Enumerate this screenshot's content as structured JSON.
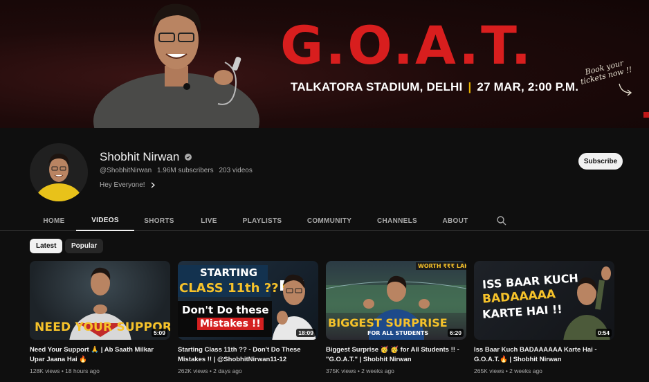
{
  "banner": {
    "headline": "G.O.A.T.",
    "venue": "TALKATORA STADIUM, DELHI",
    "separator": "|",
    "date": "27 MAR, 2:00 P.M.",
    "book_line1": "Book your",
    "book_line2": "tickets now !!"
  },
  "channel": {
    "name": "Shobhit Nirwan",
    "handle": "@ShobhitNirwan",
    "subscribers": "1.96M subscribers",
    "videos": "203 videos",
    "description": "Hey Everyone!",
    "subscribe_label": "Subscribe"
  },
  "tabs": [
    {
      "label": "HOME"
    },
    {
      "label": "VIDEOS"
    },
    {
      "label": "SHORTS"
    },
    {
      "label": "LIVE"
    },
    {
      "label": "PLAYLISTS"
    },
    {
      "label": "COMMUNITY"
    },
    {
      "label": "CHANNELS"
    },
    {
      "label": "ABOUT"
    }
  ],
  "active_tab": "VIDEOS",
  "filters": [
    {
      "label": "Latest"
    },
    {
      "label": "Popular"
    }
  ],
  "videos": [
    {
      "title": "Need Your Support 🙏 | Ab Saath Milkar Upar Jaana Hai 🔥",
      "views": "128K views",
      "age": "18 hours ago",
      "duration": "5:09",
      "thumb_text": "NEED YOUR SUPPORT 🙏"
    },
    {
      "title": "Starting Class 11th ?? - Don't Do These Mistakes !! | @ShobhitNirwan11-12",
      "views": "262K views",
      "age": "2 days ago",
      "duration": "18:09",
      "thumb_line1": "STARTING",
      "thumb_line2": "CLASS 11th ??",
      "thumb_line3": "Don't Do these",
      "thumb_line4": "Mistakes !!",
      "thumb_side": "nge!"
    },
    {
      "title": "Biggest Surprise 🥳 🥳 for All Students !! - \"G.O.A.T.\" | Shobhit Nirwan",
      "views": "375K views",
      "age": "2 weeks ago",
      "duration": "6:20",
      "thumb_top": "WORTH ₹₹₹ LAKHS",
      "thumb_line1": "BIGGEST SURPRISE",
      "thumb_line2": "FOR ALL STUDENTS"
    },
    {
      "title": "Iss Baar Kuch BADAAAAAA Karte Hai - G.O.A.T.🔥 | Shobhit Nirwan",
      "views": "265K views",
      "age": "2 weeks ago",
      "duration": "0:54",
      "thumb_line1": "ISS BAAR KUCH",
      "thumb_line2": "BADAAAAA",
      "thumb_line3": "KARTE HAI !!"
    }
  ],
  "colors": {
    "background": "#0f0f0f",
    "banner_red": "#d81e1e",
    "accent_yellow": "#e8b400",
    "text_primary": "#f1f1f1",
    "text_secondary": "#aaaaaa"
  },
  "icons": {
    "verified": "verified-check-icon",
    "chevron": "chevron-right-icon",
    "search": "search-icon"
  }
}
